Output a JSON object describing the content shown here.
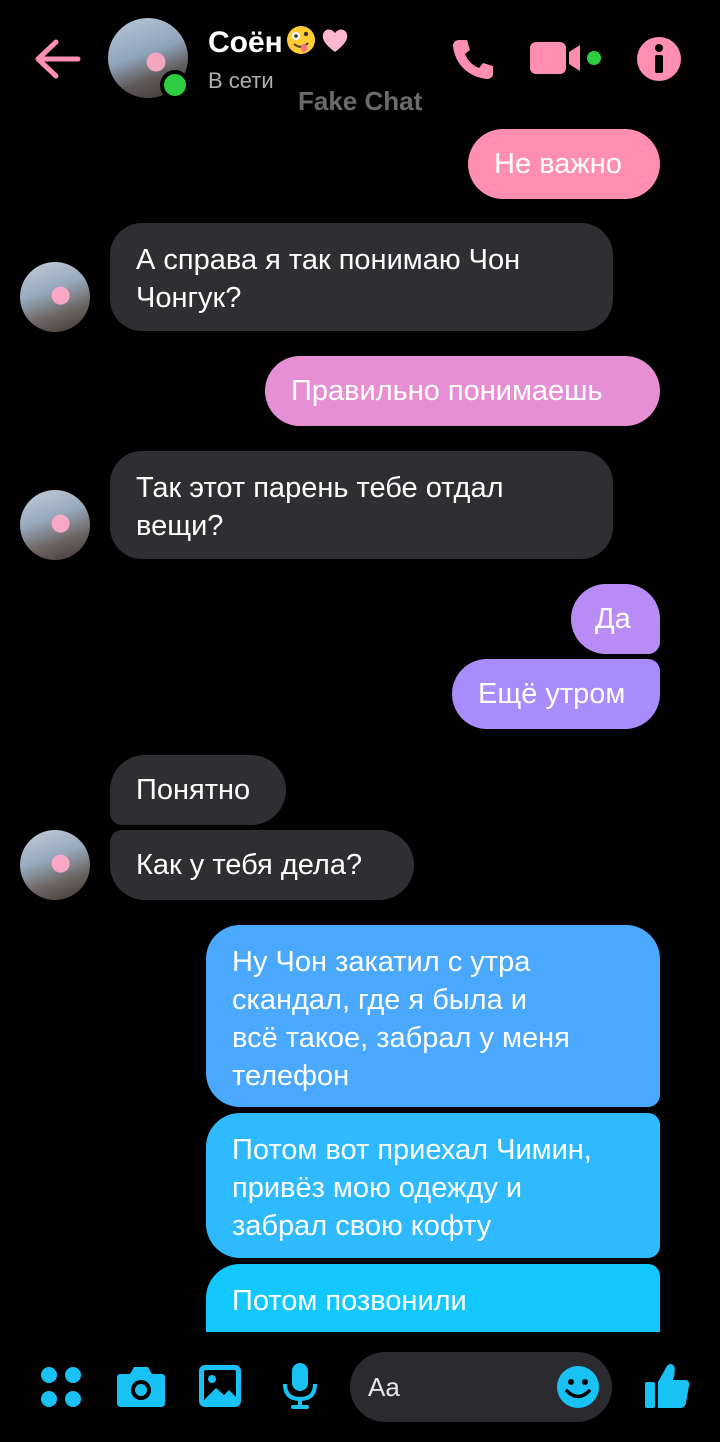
{
  "header": {
    "contact_name": "Соён",
    "status": "В сети",
    "watermark": "Fake Chat",
    "icons": [
      "back-arrow-icon",
      "phone-icon",
      "video-camera-icon",
      "info-icon"
    ],
    "accent_color": "#ff8fb1"
  },
  "messages": [
    {
      "side": "out",
      "text": "Не важно",
      "color": "#ff8fb1"
    },
    {
      "side": "in",
      "text": "А справа я так понимаю Чон\nЧонгук?",
      "color": "#2f2f33"
    },
    {
      "side": "out",
      "text": "Правильно понимаешь",
      "color": "#e68fd4"
    },
    {
      "side": "in",
      "text": "Так этот парень тебе отдал\nвещи?",
      "color": "#2f2f33"
    },
    {
      "side": "out",
      "text": "Да",
      "color": "#b98cf5"
    },
    {
      "side": "out",
      "text": "Ещё утром",
      "color": "#a98bfb"
    },
    {
      "side": "in",
      "text": "Понятно",
      "color": "#2f2f33"
    },
    {
      "side": "in",
      "text": "Как у тебя дела?",
      "color": "#2f2f33"
    },
    {
      "side": "out",
      "text": "Ну Чон закатил с утра\nскандал, где я была и\nвсё такое, забрал у меня\nтелефон",
      "color": "#4aa8ff"
    },
    {
      "side": "out",
      "text": "Потом вот приехал Чимин,\nпривёз мою одежду и\nзабрал свою кофту",
      "color": "#2fbaff"
    },
    {
      "side": "out",
      "text": "Потом позвонили",
      "color": "#12c8ff"
    }
  ],
  "composer": {
    "placeholder": "Aa",
    "icons": [
      "apps-grid-icon",
      "camera-icon",
      "gallery-icon",
      "microphone-icon",
      "emoji-icon",
      "thumbs-up-icon"
    ],
    "accent_color": "#18c2f4"
  }
}
